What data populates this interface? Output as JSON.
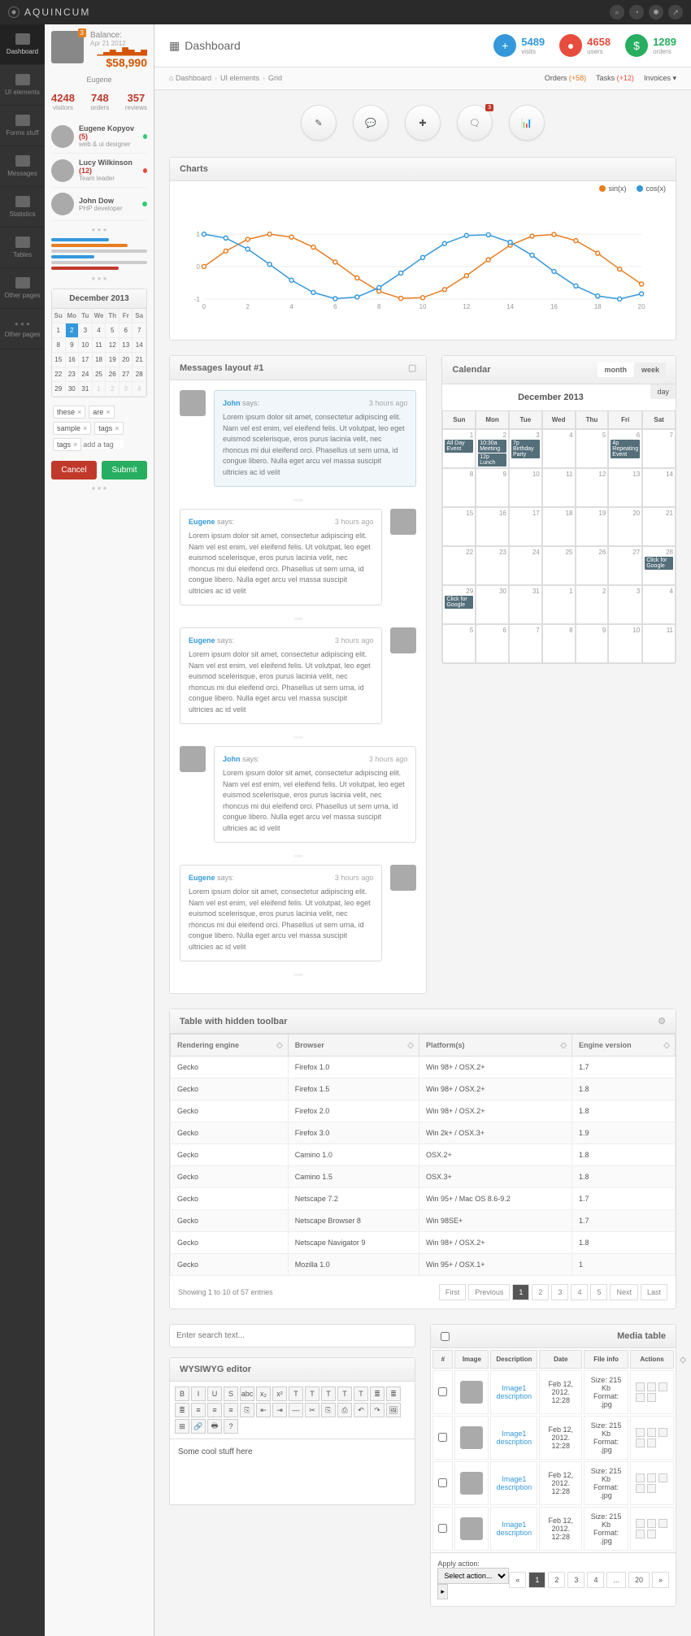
{
  "brand": "AQUINCUM",
  "profile": {
    "name": "Eugene",
    "badge": "3",
    "balance_label": "Balance:",
    "balance_date": "Apr 21 2012",
    "balance_amount": "$58,990"
  },
  "left_stats": [
    {
      "num": "4248",
      "lbl": "visitors"
    },
    {
      "num": "748",
      "lbl": "orders"
    },
    {
      "num": "357",
      "lbl": "reviews"
    }
  ],
  "sidenav": [
    {
      "lbl": "Dashboard"
    },
    {
      "lbl": "UI elements"
    },
    {
      "lbl": "Forms stuff"
    },
    {
      "lbl": "Messages"
    },
    {
      "lbl": "Statistics"
    },
    {
      "lbl": "Tables"
    },
    {
      "lbl": "Other pages"
    }
  ],
  "users": [
    {
      "name": "Eugene Kopyov",
      "count": "(5)",
      "role": "web & ui designer",
      "status": "g"
    },
    {
      "name": "Lucy Wilkinson",
      "count": "(12)",
      "role": "Team leader",
      "status": "r"
    },
    {
      "name": "John Dow",
      "count": "",
      "role": "PHP developer",
      "status": "g"
    }
  ],
  "mini_cal": {
    "title": "December 2013",
    "dh": [
      "Su",
      "Mo",
      "Tu",
      "We",
      "Th",
      "Fr",
      "Sa"
    ],
    "rows": [
      [
        "1",
        "2",
        "3",
        "4",
        "5",
        "6",
        "7"
      ],
      [
        "8",
        "9",
        "10",
        "11",
        "12",
        "13",
        "14"
      ],
      [
        "15",
        "16",
        "17",
        "18",
        "19",
        "20",
        "21"
      ],
      [
        "22",
        "23",
        "24",
        "25",
        "26",
        "27",
        "28"
      ],
      [
        "29",
        "30",
        "31",
        "1",
        "2",
        "3",
        "4"
      ]
    ],
    "selected": "2"
  },
  "tags": {
    "items": [
      "these",
      "are",
      "sample",
      "tags"
    ],
    "placeholder": "add a tag"
  },
  "buttons": {
    "cancel": "Cancel",
    "submit": "Submit"
  },
  "page_title": "Dashboard",
  "head_stats": [
    {
      "num": "5489",
      "lbl": "visits",
      "color": "blue",
      "sym": "+"
    },
    {
      "num": "4658",
      "lbl": "users",
      "color": "red",
      "sym": "●"
    },
    {
      "num": "1289",
      "lbl": "orders",
      "color": "green",
      "sym": "$"
    }
  ],
  "crumbs": {
    "path": [
      "Dashboard",
      "UI elements",
      "Grid"
    ],
    "right": [
      {
        "lbl": "Orders",
        "badge": "(+58)",
        "cls": "badge-o"
      },
      {
        "lbl": "Tasks",
        "badge": "(+12)",
        "cls": "badge-r"
      },
      {
        "lbl": "Invoices",
        "badge": "▾",
        "cls": ""
      }
    ]
  },
  "big_icon_badge": "3",
  "charts_title": "Charts",
  "chart_legend": [
    {
      "lbl": "sin(x)",
      "color": "#e67e22"
    },
    {
      "lbl": "cos(x)",
      "color": "#3498db"
    }
  ],
  "chart_data": {
    "type": "line",
    "x": [
      0,
      1,
      2,
      3,
      4,
      5,
      6,
      7,
      8,
      9,
      10,
      11,
      12,
      13,
      14,
      15,
      16,
      17,
      18,
      19,
      20
    ],
    "series": [
      {
        "name": "sin(x)",
        "color": "#e67e22",
        "values": [
          0,
          0.48,
          0.84,
          1.0,
          0.91,
          0.6,
          0.14,
          -0.35,
          -0.76,
          -0.98,
          -0.96,
          -0.71,
          -0.28,
          0.21,
          0.66,
          0.94,
          0.99,
          0.8,
          0.41,
          -0.08,
          -0.54
        ]
      },
      {
        "name": "cos(x)",
        "color": "#3498db",
        "values": [
          1,
          0.88,
          0.54,
          0.07,
          -0.42,
          -0.8,
          -0.99,
          -0.94,
          -0.65,
          -0.2,
          0.28,
          0.71,
          0.96,
          0.98,
          0.75,
          0.35,
          -0.15,
          -0.6,
          -0.91,
          -1.0,
          -0.84
        ]
      }
    ],
    "xlim": [
      0,
      20
    ],
    "ylim": [
      -1,
      1
    ],
    "xticks": [
      0,
      2,
      4,
      6,
      8,
      10,
      12,
      14,
      16,
      18,
      20
    ],
    "yticks": [
      -1,
      0,
      1
    ]
  },
  "messages_title": "Messages layout #1",
  "messages": [
    {
      "name": "John",
      "side": "left",
      "blue": true,
      "time": "3 hours ago",
      "text": "Lorem ipsum dolor sit amet, consectetur adipiscing elit. Nam vel est enim, vel eleifend felis. Ut volutpat, leo eget euismod scelerisque, eros purus lacinia velit, nec rhoncus mi dui eleifend orci. Phasellus ut sem urna, id congue libero. Nulla eget arcu vel massa suscipit ultricies ac id velit"
    },
    {
      "name": "Eugene",
      "side": "right",
      "blue": false,
      "time": "3 hours ago",
      "text": "Lorem ipsum dolor sit amet, consectetur adipiscing elit. Nam vel est enim, vel eleifend felis. Ut volutpat, leo eget euismod scelerisque, eros purus lacinia velit, nec rhoncus mi dui eleifend orci. Phasellus ut sem urna, id congue libero. Nulla eget arcu vel massa suscipit ultricies ac id velit"
    },
    {
      "name": "Eugene",
      "side": "right",
      "blue": false,
      "time": "3 hours ago",
      "text": "Lorem ipsum dolor sit amet, consectetur adipiscing elit. Nam vel est enim, vel eleifend felis. Ut volutpat, leo eget euismod scelerisque, eros purus lacinia velit, nec rhoncus mi dui eleifend orci. Phasellus ut sem urna, id congue libero. Nulla eget arcu vel massa suscipit ultricies ac id velit"
    },
    {
      "name": "John",
      "side": "left",
      "blue": false,
      "time": "3 hours ago",
      "text": "Lorem ipsum dolor sit amet, consectetur adipiscing elit. Nam vel est enim, vel eleifend felis. Ut volutpat, leo eget euismod scelerisque, eros purus lacinia velit, nec rhoncus mi dui eleifend orci. Phasellus ut sem urna, id congue libero. Nulla eget arcu vel massa suscipit ultricies ac id velit"
    },
    {
      "name": "Eugene",
      "side": "right",
      "blue": false,
      "time": "3 hours ago",
      "text": "Lorem ipsum dolor sit amet, consectetur adipiscing elit. Nam vel est enim, vel eleifend felis. Ut volutpat, leo eget euismod scelerisque, eros purus lacinia velit, nec rhoncus mi dui eleifend orci. Phasellus ut sem urna, id congue libero. Nulla eget arcu vel massa suscipit ultricies ac id velit"
    }
  ],
  "calendar": {
    "title": "Calendar",
    "month_label": "December 2013",
    "tabs": [
      "month",
      "week"
    ],
    "day_btn": "day",
    "dh": [
      "Sun",
      "Mon",
      "Tue",
      "Wed",
      "Thu",
      "Fri",
      "Sat"
    ],
    "cells": [
      [
        {
          "d": "1",
          "ev": [
            "All Day Event"
          ]
        },
        {
          "d": "2",
          "ev": [
            "10:30a Meeting",
            "12p Lunch"
          ]
        },
        {
          "d": "3",
          "ev": [
            "7p Birthday Party"
          ]
        },
        {
          "d": "4",
          "ev": []
        },
        {
          "d": "5",
          "ev": []
        },
        {
          "d": "6",
          "ev": [
            "4p Repeating Event"
          ]
        },
        {
          "d": "7",
          "ev": []
        }
      ],
      [
        {
          "d": "8",
          "ev": []
        },
        {
          "d": "9",
          "ev": []
        },
        {
          "d": "10",
          "ev": []
        },
        {
          "d": "11",
          "ev": []
        },
        {
          "d": "12",
          "ev": []
        },
        {
          "d": "13",
          "ev": []
        },
        {
          "d": "14",
          "ev": []
        }
      ],
      [
        {
          "d": "15",
          "ev": []
        },
        {
          "d": "16",
          "ev": []
        },
        {
          "d": "17",
          "ev": []
        },
        {
          "d": "18",
          "ev": []
        },
        {
          "d": "19",
          "ev": []
        },
        {
          "d": "20",
          "ev": []
        },
        {
          "d": "21",
          "ev": []
        }
      ],
      [
        {
          "d": "22",
          "ev": []
        },
        {
          "d": "23",
          "ev": []
        },
        {
          "d": "24",
          "ev": []
        },
        {
          "d": "25",
          "ev": []
        },
        {
          "d": "26",
          "ev": []
        },
        {
          "d": "27",
          "ev": []
        },
        {
          "d": "28",
          "ev": [
            "Click for Google"
          ]
        }
      ],
      [
        {
          "d": "29",
          "ev": [
            "Click for Google"
          ]
        },
        {
          "d": "30",
          "ev": []
        },
        {
          "d": "31",
          "ev": []
        },
        {
          "d": "1",
          "ev": []
        },
        {
          "d": "2",
          "ev": []
        },
        {
          "d": "3",
          "ev": []
        },
        {
          "d": "4",
          "ev": []
        }
      ],
      [
        {
          "d": "5",
          "ev": []
        },
        {
          "d": "6",
          "ev": []
        },
        {
          "d": "7",
          "ev": []
        },
        {
          "d": "8",
          "ev": []
        },
        {
          "d": "9",
          "ev": []
        },
        {
          "d": "10",
          "ev": []
        },
        {
          "d": "11",
          "ev": []
        }
      ]
    ]
  },
  "table": {
    "title": "Table with hidden toolbar",
    "headers": [
      "Rendering engine",
      "Browser",
      "Platform(s)",
      "Engine version"
    ],
    "rows": [
      [
        "Gecko",
        "Firefox 1.0",
        "Win 98+ / OSX.2+",
        "1.7"
      ],
      [
        "Gecko",
        "Firefox 1.5",
        "Win 98+ / OSX.2+",
        "1.8"
      ],
      [
        "Gecko",
        "Firefox 2.0",
        "Win 98+ / OSX.2+",
        "1.8"
      ],
      [
        "Gecko",
        "Firefox 3.0",
        "Win 2k+ / OSX.3+",
        "1.9"
      ],
      [
        "Gecko",
        "Camino 1.0",
        "OSX.2+",
        "1.8"
      ],
      [
        "Gecko",
        "Camino 1.5",
        "OSX.3+",
        "1.8"
      ],
      [
        "Gecko",
        "Netscape 7.2",
        "Win 95+ / Mac OS 8.6-9.2",
        "1.7"
      ],
      [
        "Gecko",
        "Netscape Browser 8",
        "Win 98SE+",
        "1.7"
      ],
      [
        "Gecko",
        "Netscape Navigator 9",
        "Win 98+ / OSX.2+",
        "1.8"
      ],
      [
        "Gecko",
        "Mozilla 1.0",
        "Win 95+ / OSX.1+",
        "1"
      ]
    ],
    "info": "Showing 1 to 10 of 57 entries",
    "pager": [
      "First",
      "Previous",
      "1",
      "2",
      "3",
      "4",
      "5",
      "Next",
      "Last"
    ]
  },
  "search_placeholder": "Enter search text...",
  "editor": {
    "title": "WYSIWYG editor",
    "content": "Some cool stuff here",
    "buttons": [
      "B",
      "I",
      "U",
      "S",
      "abc",
      "x₂",
      "x²",
      "T",
      "T",
      "T",
      "T",
      "T",
      "≣",
      "≣",
      "≣",
      "≡",
      "≡",
      "≡",
      "⎘",
      "⇤",
      "⇥",
      "—",
      "✂",
      "⎘",
      "⎙",
      "↶",
      "↷",
      "🖼",
      "⊞",
      "🔗",
      "🖶",
      "?"
    ]
  },
  "media": {
    "title": "Media table",
    "headers": [
      "#",
      "Image",
      "Description",
      "Date",
      "File info",
      "Actions"
    ],
    "rows": [
      {
        "desc": "Image1",
        "link": "description",
        "date": "Feb 12, 2012.",
        "time": "12:28",
        "size": "Size: 215 Kb",
        "fmt": "Format: .jpg"
      },
      {
        "desc": "Image1",
        "link": "description",
        "date": "Feb 12, 2012.",
        "time": "12:28",
        "size": "Size: 215 Kb",
        "fmt": "Format: .jpg"
      },
      {
        "desc": "Image1",
        "link": "description",
        "date": "Feb 12, 2012.",
        "time": "12:28",
        "size": "Size: 215 Kb",
        "fmt": "Format: .jpg"
      },
      {
        "desc": "Image1",
        "link": "description",
        "date": "Feb 12, 2012.",
        "time": "12:28",
        "size": "Size: 215 Kb",
        "fmt": "Format: .jpg"
      }
    ],
    "apply_label": "Apply action:",
    "apply_select": "Select action...",
    "pager": [
      "«",
      "1",
      "2",
      "3",
      "4",
      "...",
      "20",
      "»"
    ]
  },
  "says_label": "says:"
}
